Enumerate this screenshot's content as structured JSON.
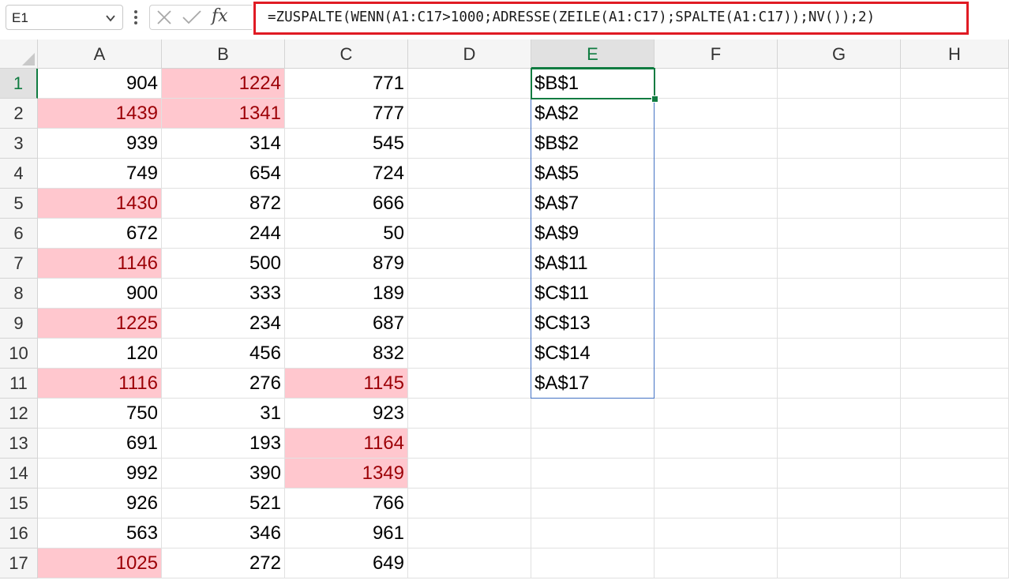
{
  "name_box": {
    "value": "E1"
  },
  "formula_bar": {
    "fx_label": "fx",
    "formula": "=ZUSPALTE(WENN(A1:C17>1000;ADRESSE(ZEILE(A1:C17);SPALTE(A1:C17));NV());2)"
  },
  "colors": {
    "highlight_fill": "#ffc7ce",
    "highlight_text": "#9c0006",
    "selection": "#107c41",
    "spill_border": "#4472c4",
    "callout_border": "#e01b24"
  },
  "columns": [
    "A",
    "B",
    "C",
    "D",
    "E",
    "F",
    "G",
    "H"
  ],
  "active_cell": {
    "col": "E",
    "row": 1
  },
  "rows": [
    {
      "n": "1",
      "A": "904",
      "B": "1224",
      "C": "771",
      "E": "$B$1",
      "hl": [
        "B"
      ]
    },
    {
      "n": "2",
      "A": "1439",
      "B": "1341",
      "C": "777",
      "E": "$A$2",
      "hl": [
        "A",
        "B"
      ]
    },
    {
      "n": "3",
      "A": "939",
      "B": "314",
      "C": "545",
      "E": "$B$2",
      "hl": []
    },
    {
      "n": "4",
      "A": "749",
      "B": "654",
      "C": "724",
      "E": "$A$5",
      "hl": []
    },
    {
      "n": "5",
      "A": "1430",
      "B": "872",
      "C": "666",
      "E": "$A$7",
      "hl": [
        "A"
      ]
    },
    {
      "n": "6",
      "A": "672",
      "B": "244",
      "C": "50",
      "E": "$A$9",
      "hl": []
    },
    {
      "n": "7",
      "A": "1146",
      "B": "500",
      "C": "879",
      "E": "$A$11",
      "hl": [
        "A"
      ]
    },
    {
      "n": "8",
      "A": "900",
      "B": "333",
      "C": "189",
      "E": "$C$11",
      "hl": []
    },
    {
      "n": "9",
      "A": "1225",
      "B": "234",
      "C": "687",
      "E": "$C$13",
      "hl": [
        "A"
      ]
    },
    {
      "n": "10",
      "A": "120",
      "B": "456",
      "C": "832",
      "E": "$C$14",
      "hl": []
    },
    {
      "n": "11",
      "A": "1116",
      "B": "276",
      "C": "1145",
      "E": "$A$17",
      "hl": [
        "A",
        "C"
      ]
    },
    {
      "n": "12",
      "A": "750",
      "B": "31",
      "C": "923",
      "E": "",
      "hl": []
    },
    {
      "n": "13",
      "A": "691",
      "B": "193",
      "C": "1164",
      "E": "",
      "hl": [
        "C"
      ]
    },
    {
      "n": "14",
      "A": "992",
      "B": "390",
      "C": "1349",
      "E": "",
      "hl": [
        "C"
      ]
    },
    {
      "n": "15",
      "A": "926",
      "B": "521",
      "C": "766",
      "E": "",
      "hl": []
    },
    {
      "n": "16",
      "A": "563",
      "B": "346",
      "C": "961",
      "E": "",
      "hl": []
    },
    {
      "n": "17",
      "A": "1025",
      "B": "272",
      "C": "649",
      "E": "",
      "hl": [
        "A"
      ]
    }
  ]
}
